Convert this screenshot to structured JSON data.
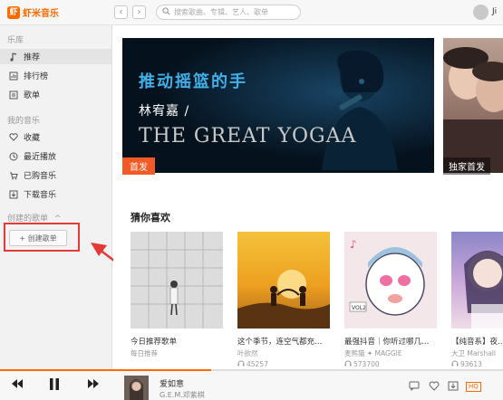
{
  "app": {
    "name": "虾米音乐",
    "logo_glyph": "虾"
  },
  "topbar": {
    "back_glyph": "‹",
    "forward_glyph": "›",
    "search_placeholder": "搜索歌曲、专辑、艺人、歌单",
    "user_initial": "Ji"
  },
  "sidebar": {
    "library_title": "乐库",
    "library_items": [
      {
        "label": "推荐",
        "icon": "music-note-icon",
        "active": true
      },
      {
        "label": "排行榜",
        "icon": "chart-icon",
        "active": false
      },
      {
        "label": "歌单",
        "icon": "playlist-icon",
        "active": false
      }
    ],
    "my_music_title": "我的音乐",
    "my_items": [
      {
        "label": "收藏",
        "icon": "heart-icon"
      },
      {
        "label": "最近播放",
        "icon": "clock-icon"
      },
      {
        "label": "已购音乐",
        "icon": "cart-icon"
      },
      {
        "label": "下载音乐",
        "icon": "download-icon"
      }
    ],
    "created_title": "创建的歌单",
    "created_toggle": "^",
    "create_button": "+ 创建歌单"
  },
  "banner": {
    "title": "推动摇篮的手",
    "artist": "林宥嘉 /",
    "english": "THE GREAT YOGAA",
    "badge": "首发",
    "side_badge": "独家首发"
  },
  "recommend": {
    "title": "猜你喜欢",
    "cards": [
      {
        "title": "今日推荐歌单",
        "sub": "每日推荐",
        "count": ""
      },
      {
        "title": "这个季节，连空气都充…",
        "sub": "叶欲然",
        "count": "45257"
      },
      {
        "title": "最强抖音｜你听过哪几…",
        "sub": "麦熊猫 ✦ MAGGIE",
        "count": "573700"
      },
      {
        "title": "【纯音系】夜…",
        "sub": "大卫 Marshall",
        "count": "93613"
      }
    ]
  },
  "player": {
    "prev_glyph": "⏮",
    "pause_glyph": "❚❚",
    "next_glyph": "⏭",
    "song": "爱如意",
    "artist": "G.E.M.邓紫棋",
    "progress": 0.42,
    "quality": "HQ"
  },
  "colors": {
    "accent": "#ff6a00",
    "highlight": "#e53935"
  }
}
